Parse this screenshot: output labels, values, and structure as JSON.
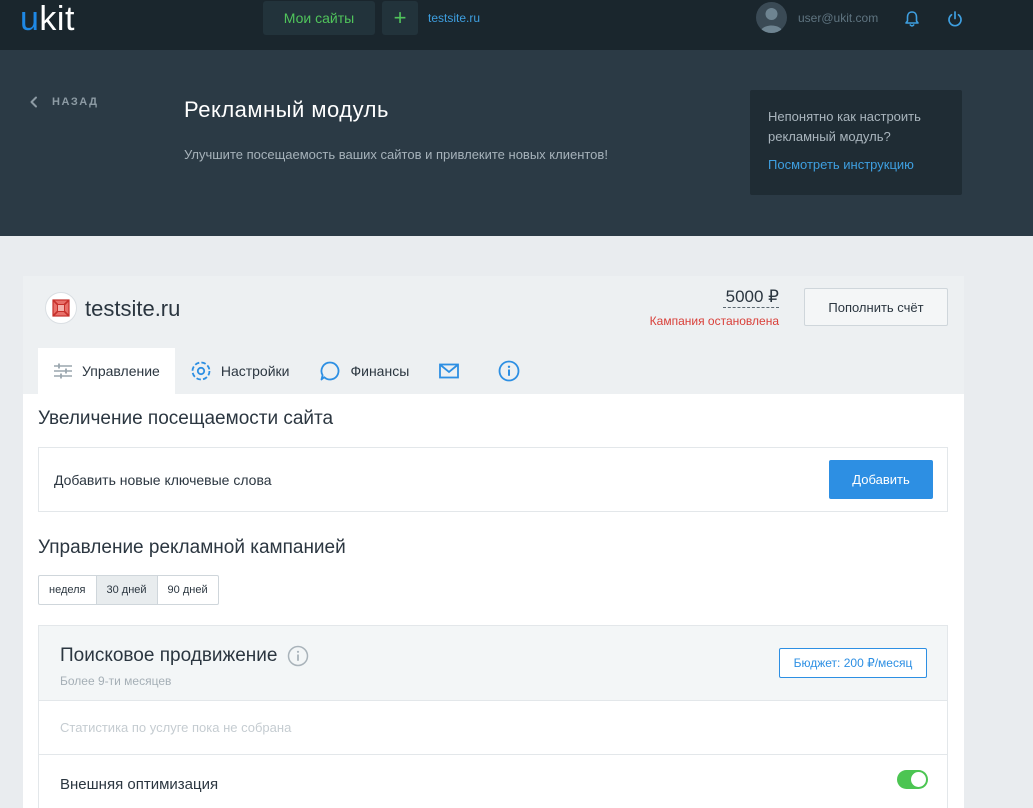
{
  "topbar": {
    "logo_u": "u",
    "logo_rest": "kit",
    "my_sites_label": "Мои сайты",
    "add_label": "+",
    "current_site": "testsite.ru",
    "user_email": "user@ukit.com"
  },
  "header": {
    "back_label": "НАЗАД",
    "title": "Рекламный модуль",
    "subtitle": "Улучшите посещаемость ваших сайтов и привлеките новых клиентов!",
    "help_question": "Непонятно как настроить рекламный модуль?",
    "help_link": "Посмотреть инструкцию"
  },
  "site": {
    "name": "testsite.ru",
    "balance": "5000 ₽",
    "status": "Кампания остановлена",
    "topup_label": "Пополнить счёт"
  },
  "tabs": [
    {
      "label": "Управление",
      "icon": "sliders-icon"
    },
    {
      "label": "Настройки",
      "icon": "gear-icon"
    },
    {
      "label": "Финансы",
      "icon": "chat-icon"
    },
    {
      "label": "",
      "icon": "mail-icon"
    },
    {
      "label": "",
      "icon": "info-icon"
    }
  ],
  "traffic": {
    "title": "Увеличение посещаемости сайта",
    "keywords_label": "Добавить новые ключевые слова",
    "add_button": "Добавить"
  },
  "campaign": {
    "title": "Управление рекламной кампанией",
    "periods": [
      "неделя",
      "30 дней",
      "90 дней"
    ],
    "active_period": "30 дней"
  },
  "promotion": {
    "title": "Поисковое продвижение",
    "subtitle": "Более 9-ти месяцев",
    "budget": "Бюджет: 200 ₽/месяц",
    "stats_empty": "Статистика по услуге пока не собрана",
    "external_label": "Внешняя оптимизация",
    "external_enabled": true
  },
  "colors": {
    "topbar_bg": "#1a262d",
    "header_bg": "#2b3a45",
    "accent_blue": "#2d8fe3",
    "accent_green": "#50c45b",
    "error_red": "#d9403a"
  }
}
